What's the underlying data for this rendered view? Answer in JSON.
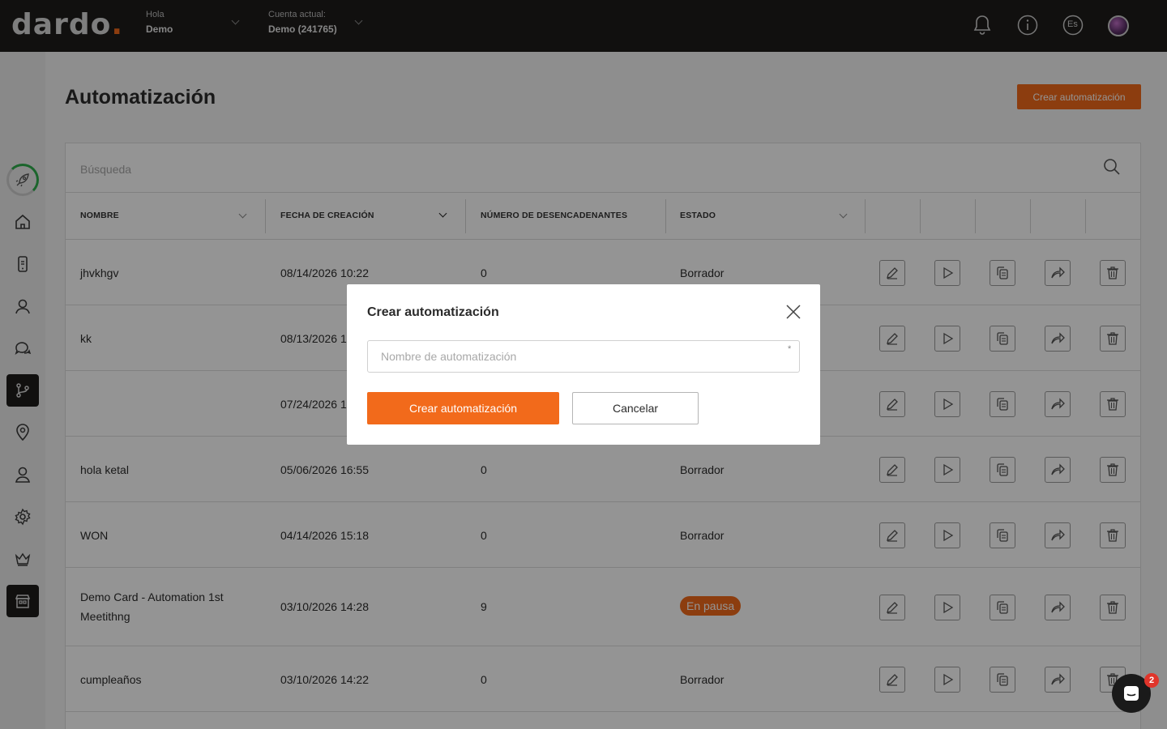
{
  "brand": {
    "logo_main": "dardo",
    "logo_dot": ".",
    "accent": "#f26a1b"
  },
  "header": {
    "greeting_label": "Hola",
    "user_name": "Demo",
    "account_label": "Cuenta actual:",
    "account_value": "Demo (241765)",
    "language": "Es",
    "icons": [
      "bell-icon",
      "info-icon",
      "language-icon",
      "avatar"
    ]
  },
  "sidebar": {
    "items": [
      "rocket-icon",
      "home-icon",
      "mobile-icon",
      "contacts-icon",
      "chat-icon",
      "automation-icon",
      "location-icon",
      "user-icon",
      "gear-icon",
      "crown-icon",
      "store-icon"
    ]
  },
  "page": {
    "title": "Automatización",
    "create_button": "Crear automatización",
    "search_placeholder": "Búsqueda"
  },
  "table": {
    "columns": [
      "NOMBRE",
      "FECHA DE CREACIÓN",
      "NÚMERO DE DESENCADENANTES",
      "ESTADO"
    ],
    "rows": [
      {
        "name": "jhvkhgv",
        "date": "08/14/2026 10:22",
        "triggers": "0",
        "status": "Borrador"
      },
      {
        "name": "kk",
        "date": "08/13/2026 1",
        "triggers": "",
        "status": ""
      },
      {
        "name": "",
        "date": "07/24/2026 1",
        "triggers": "",
        "status": ""
      },
      {
        "name": "hola ketal",
        "date": "05/06/2026 16:55",
        "triggers": "0",
        "status": "Borrador"
      },
      {
        "name": "WON",
        "date": "04/14/2026 15:18",
        "triggers": "0",
        "status": "Borrador"
      },
      {
        "name_line1": "Demo Card - Automation 1st",
        "name_line2": "Meetithng",
        "date": "03/10/2026 14:28",
        "triggers": "9",
        "status": "En pausa"
      },
      {
        "name": "cumpleaños",
        "date": "03/10/2026 14:22",
        "triggers": "0",
        "status": "Borrador"
      }
    ]
  },
  "modal": {
    "title": "Crear automatización",
    "input_placeholder": "Nombre de automatización",
    "required_mark": "*",
    "create_button": "Crear automatización",
    "cancel_button": "Cancelar"
  },
  "chat": {
    "unread_count": "2"
  }
}
